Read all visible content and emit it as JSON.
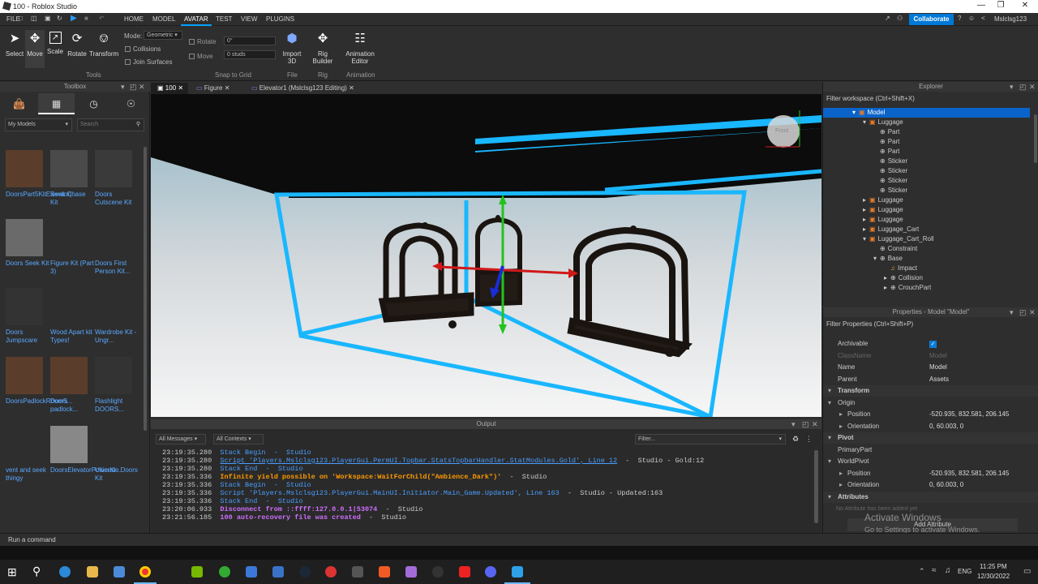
{
  "window": {
    "title": "100 - Roblox Studio"
  },
  "menu": {
    "file": "FILE",
    "home": "HOME",
    "model": "MODEL",
    "avatar": "AVATAR",
    "test": "TEST",
    "view": "VIEW",
    "plugins": "PLUGINS",
    "collaborate": "Collaborate",
    "username": "Mslclsg123"
  },
  "ribbon": {
    "select": "Select",
    "move": "Move",
    "scale": "Scale",
    "rotate": "Rotate",
    "transform": "Transform",
    "mode_label": "Mode:",
    "mode_value": "Geometric",
    "collisions": "Collisions",
    "join_surfaces": "Join Surfaces",
    "tools_group": "Tools",
    "rotate_label": "Rotate",
    "rotate_value": "0°",
    "move_label": "Move",
    "move_value": "0 studs",
    "snap_group": "Snap to Grid",
    "import3d": "Import 3D",
    "file_group": "File",
    "rig_builder": "Rig Builder",
    "rig_group": "Rig",
    "anim_editor": "Animation Editor",
    "anim_group": "Animation"
  },
  "toolbox": {
    "title": "Toolbox",
    "category": "My Models",
    "search_placeholder": "Search",
    "items": [
      {
        "label": "DoorsPart5KitElevator|..."
      },
      {
        "label": "Seek Chase Kit"
      },
      {
        "label": "Doors Cutscene Kit"
      },
      {
        "label": "Doors Seek Kit"
      },
      {
        "label": "Figure Kit (Part 3)"
      },
      {
        "label": "Doors First Person Kit..."
      },
      {
        "label": "Doors Jumpscare"
      },
      {
        "label": "Wood Apart kit Types!"
      },
      {
        "label": "Wardrobe Kit - Ungr..."
      },
      {
        "label": "DoorsPadlockRoom5..."
      },
      {
        "label": "Doors padlock..."
      },
      {
        "label": "Flashlight DOORS..."
      },
      {
        "label": "vent and seek thingy"
      },
      {
        "label": "DoorsElevatorPowerKi..."
      },
      {
        "label": "Ultimate Doors Kit"
      }
    ]
  },
  "doc_tabs": [
    {
      "label": "100"
    },
    {
      "label": "Figure"
    },
    {
      "label": "Elevator1 (Mslclsg123 Editing)"
    }
  ],
  "viewport": {
    "view_cube_label": "Front"
  },
  "output": {
    "title": "Output",
    "all_messages": "All Messages",
    "all_contexts": "All Contexts",
    "filter_placeholder": "Filter...",
    "lines": [
      {
        "time": "23:19:35.280",
        "text": "Stack Begin  -  Studio",
        "color": "#4a9eff"
      },
      {
        "time": "23:19:35.280",
        "text": "Script 'Players.Mslclsg123.PlayerGui.PermUI.Topbar.StatsTopbarHandler.StatModules.Gold', Line 12",
        "suffix": "  -  Studio - Gold:12",
        "color": "#4a9eff",
        "underline": true
      },
      {
        "time": "23:19:35.280",
        "text": "Stack End  -  Studio",
        "color": "#4a9eff"
      },
      {
        "time": "23:19:35.336",
        "text": "Infinite yield possible on 'Workspace:WaitForChild(\"Ambience_Dark\")'",
        "suffix": "  -  Studio",
        "color": "#ff9a00",
        "bold": true
      },
      {
        "time": "23:19:35.336",
        "text": "Stack Begin  -  Studio",
        "color": "#4a9eff"
      },
      {
        "time": "23:19:35.336",
        "text": "Script 'Players.Mslclsg123.PlayerGui.MainUI.Initiator.Main_Game.Updated', Line 163",
        "suffix": "  -  Studio - Updated:163",
        "color": "#4a9eff"
      },
      {
        "time": "23:19:35.336",
        "text": "Stack End  -  Studio",
        "color": "#4a9eff"
      },
      {
        "time": "23:20:06.933",
        "text": "Disconnect from ::ffff:127.0.0.1|53074",
        "suffix": "  -  Studio",
        "color": "#d070ff",
        "bold": true
      },
      {
        "time": "23:21:56.185",
        "text": "100 auto-recovery file was created",
        "suffix": "  -  Studio",
        "color": "#d070ff",
        "bold": true
      }
    ]
  },
  "explorer": {
    "title": "Explorer",
    "filter_placeholder": "Filter workspace (Ctrl+Shift+X)",
    "nodes": [
      {
        "label": "Model",
        "depth": 0,
        "icon": "model",
        "selected": true,
        "expanded": true
      },
      {
        "label": "Luggage",
        "depth": 1,
        "icon": "model",
        "expanded": true
      },
      {
        "label": "Part",
        "depth": 2,
        "icon": "part"
      },
      {
        "label": "Part",
        "depth": 2,
        "icon": "part"
      },
      {
        "label": "Part",
        "depth": 2,
        "icon": "part"
      },
      {
        "label": "Sticker",
        "depth": 2,
        "icon": "part"
      },
      {
        "label": "Sticker",
        "depth": 2,
        "icon": "part"
      },
      {
        "label": "Sticker",
        "depth": 2,
        "icon": "part"
      },
      {
        "label": "Sticker",
        "depth": 2,
        "icon": "part"
      },
      {
        "label": "Luggage",
        "depth": 1,
        "icon": "model",
        "collapsed": true
      },
      {
        "label": "Luggage",
        "depth": 1,
        "icon": "model",
        "collapsed": true
      },
      {
        "label": "Luggage",
        "depth": 1,
        "icon": "model",
        "collapsed": true
      },
      {
        "label": "Luggage_Cart",
        "depth": 1,
        "icon": "model",
        "collapsed": true
      },
      {
        "label": "Luggage_Cart_Roll",
        "depth": 1,
        "icon": "model",
        "expanded": true
      },
      {
        "label": "Constraint",
        "depth": 2,
        "icon": "constraint"
      },
      {
        "label": "Base",
        "depth": 2,
        "icon": "part",
        "expanded": true
      },
      {
        "label": "Impact",
        "depth": 3,
        "icon": "sound"
      },
      {
        "label": "Collision",
        "depth": 3,
        "icon": "part",
        "collapsed": true
      },
      {
        "label": "CrouchPart",
        "depth": 3,
        "icon": "part",
        "collapsed": true
      }
    ]
  },
  "properties": {
    "title": "Properties - Model \"Model\"",
    "filter_placeholder": "Filter Properties (Ctrl+Shift+P)",
    "rows": [
      {
        "key": "Archivable",
        "checkbox": true
      },
      {
        "key": "ClassName",
        "value": "Model",
        "dim": true
      },
      {
        "key": "Name",
        "value": "Model"
      },
      {
        "key": "Parent",
        "value": "Assets"
      },
      {
        "key": "Transform",
        "category": true
      },
      {
        "key": "Origin",
        "sub": true
      },
      {
        "key": "Position",
        "value": "-520.935, 832.581, 206.145",
        "indent": true
      },
      {
        "key": "Orientation",
        "value": "0, 60.003, 0",
        "indent": true
      },
      {
        "key": "Pivot",
        "category": true
      },
      {
        "key": "PrimaryPart",
        "value": ""
      },
      {
        "key": "WorldPivot",
        "sub": true
      },
      {
        "key": "Position",
        "value": "-520.935, 832.581, 206.145",
        "indent": true
      },
      {
        "key": "Orientation",
        "value": "0, 60.003, 0",
        "indent": true
      },
      {
        "key": "Attributes",
        "category": true
      }
    ],
    "no_attribute": "No Attribute has been added yet",
    "add_attribute": "Add Attribute"
  },
  "activate": {
    "line1": "Activate Windows",
    "line2": "Go to Settings to activate Windows."
  },
  "command_bar": {
    "placeholder": "Run a command"
  },
  "taskbar": {
    "time": "11:25 PM",
    "date": "12/30/2022",
    "lang": "ENG"
  }
}
